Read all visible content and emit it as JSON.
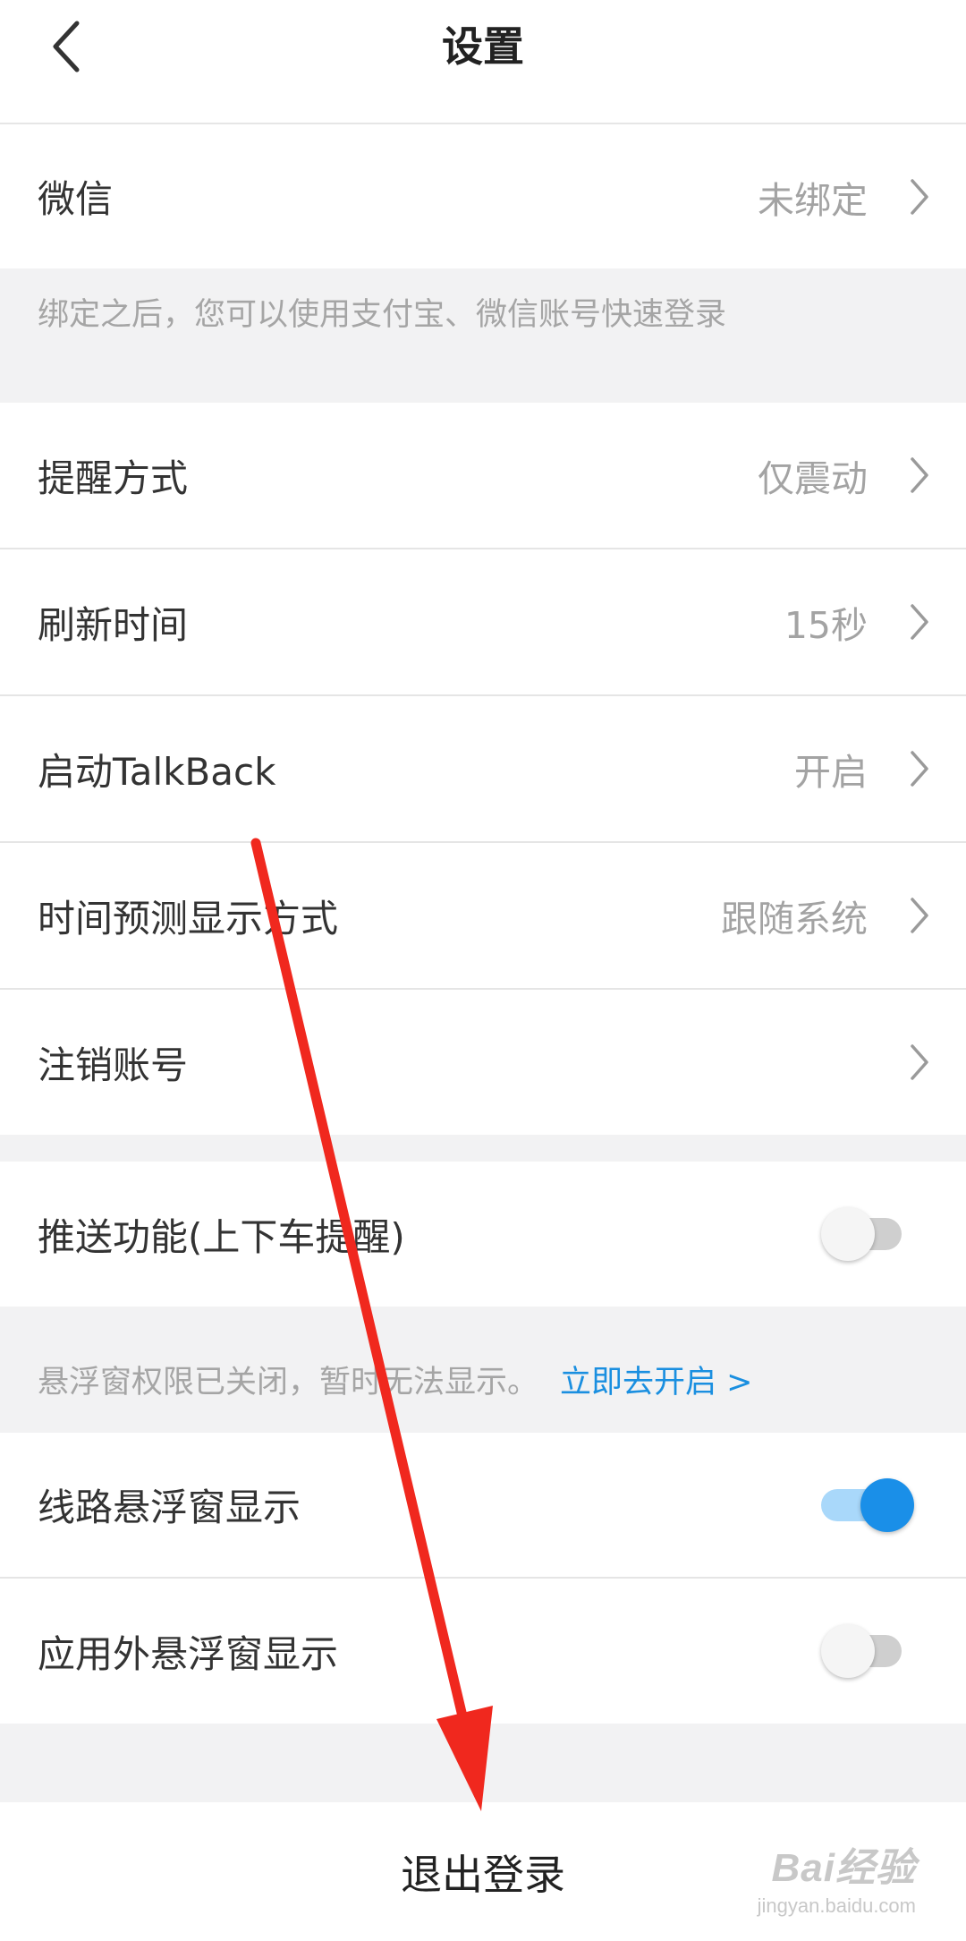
{
  "header": {
    "title": "设置"
  },
  "wechat": {
    "label": "微信",
    "value": "未绑定"
  },
  "bind_note": "绑定之后，您可以使用支付宝、微信账号快速登录",
  "settings": [
    {
      "label": "提醒方式",
      "value": "仅震动"
    },
    {
      "label": "刷新时间",
      "value": "15秒"
    },
    {
      "label": "启动TalkBack",
      "value": "开启"
    },
    {
      "label": "时间预测显示方式",
      "value": "跟随系统"
    },
    {
      "label": "注销账号",
      "value": ""
    }
  ],
  "push": {
    "label": "推送功能(上下车提醒)",
    "enabled": false
  },
  "float_note": {
    "text": "悬浮窗权限已关闭，暂时无法显示。",
    "link": "立即去开启 >"
  },
  "float_toggles": [
    {
      "label": "线路悬浮窗显示",
      "enabled": true
    },
    {
      "label": "应用外悬浮窗显示",
      "enabled": false
    }
  ],
  "logout_label": "退出登录",
  "watermark": {
    "main": "Bai经验",
    "sub": "jingyan.baidu.com"
  },
  "colors": {
    "accent": "#1a8fe8",
    "annotation_arrow": "#f0281e"
  }
}
